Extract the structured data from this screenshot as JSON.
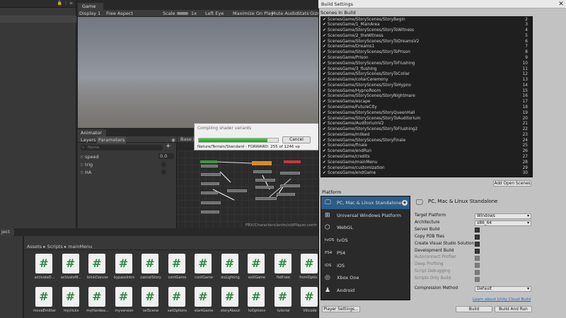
{
  "hierarchy": {
    "icons": "🔒 ⋮ ≡"
  },
  "game": {
    "tab_label": "Game",
    "display": "Display 1",
    "aspect": "Free Aspect",
    "scale_label": "Scale",
    "scale_value": "1x",
    "eye": "Left Eye",
    "maximize": "Maximize On Play",
    "mute": "Mute Audio",
    "stats": "Stats",
    "gizmos": "Gizmos"
  },
  "animator": {
    "tab_label": "Animator",
    "layers_tab": "Layers",
    "parameters_tab": "Parameters",
    "base_layer": "Base Layer",
    "search_placeholder": "Name",
    "add_label": "+",
    "params": [
      {
        "name": "speed",
        "value": "0.0"
      },
      {
        "name": "trig",
        "value": ""
      },
      {
        "name": "HA",
        "value": ""
      }
    ],
    "status_path": "FBX/Characters/anim/oldPlayer.contr"
  },
  "compile_dialog": {
    "title": "Compiling shader variants",
    "progress": 0.87,
    "cancel_label": "Cancel",
    "status": "Nature/Terrain/Standard - FORWARD: 255 of 1246 vp"
  },
  "project": {
    "tab_label": "ject",
    "breadcrumb": [
      "Assets",
      "Scripts",
      "mainMenu"
    ],
    "row1": [
      "activateD...",
      "activateM...",
      "blinkDancer",
      "bypassIntro",
      "cancelStory",
      "contGame",
      "contGame",
      "doLighting",
      "exitGame",
      "fieKnee",
      "fromOptio..."
    ],
    "row2": [
      "moveEmitter",
      "myclicks",
      "myHardwa...",
      "myversion",
      "selScene",
      "setOptions",
      "startGame",
      "storyAbout",
      "toOptions",
      "tutorial",
      "Viiicode"
    ]
  },
  "build_settings": {
    "window_title": "Build Settings",
    "close_icon": "✕",
    "scenes_header": "Scenes In Build",
    "scenes": [
      {
        "name": "ScenesGame/StoryScenes/StoryBegin",
        "index": "2"
      },
      {
        "name": "ScenesGame/1_MainArea",
        "index": "3"
      },
      {
        "name": "ScenesGame/StoryScenes/StoryToWitness",
        "index": "4"
      },
      {
        "name": "ScenesGame/2_theWitness",
        "index": "5"
      },
      {
        "name": "ScenesGame/StoryScenes/StoryToDreamsV2",
        "index": "6"
      },
      {
        "name": "ScenesGame/Dreams1",
        "index": "7"
      },
      {
        "name": "ScenesGame/StoryScenes/StoryToPrison",
        "index": "8"
      },
      {
        "name": "ScenesGame/Prison",
        "index": "9"
      },
      {
        "name": "ScenesGame/StoryScenes/StoryToFlushing",
        "index": "10"
      },
      {
        "name": "ScenesGame/3_flushing",
        "index": "11"
      },
      {
        "name": "ScenesGame/StoryScenes/StoryToCollar",
        "index": "12"
      },
      {
        "name": "ScenesGame/collarCeremony",
        "index": "13"
      },
      {
        "name": "ScenesGame/StoryScenes/StoryToHypno",
        "index": "14"
      },
      {
        "name": "ScenesGame/HypnoRoom",
        "index": "15"
      },
      {
        "name": "ScenesGame/StoryScenes/StoryNightmare",
        "index": "16"
      },
      {
        "name": "ScenesGame/escape",
        "index": "17"
      },
      {
        "name": "ScenesGame/FutureCity",
        "index": "18"
      },
      {
        "name": "ScenesGame/StoryScenes/StoryQueenHall",
        "index": "19"
      },
      {
        "name": "ScenesGame/StoryScenes/StoryToAuditorium",
        "index": "20"
      },
      {
        "name": "ScenesGame/AuditoriumV2",
        "index": "21"
      },
      {
        "name": "ScenesGame/StoryScenes/StoryToFlushing2",
        "index": "22"
      },
      {
        "name": "ScenesGame/milked",
        "index": "23"
      },
      {
        "name": "ScenesGame/StoryScenes/StoryFinale",
        "index": "24"
      },
      {
        "name": "ScenesGame/finale",
        "index": "25"
      },
      {
        "name": "ScenesGame/endRun",
        "index": "26"
      },
      {
        "name": "ScenesGame/credits",
        "index": "27"
      },
      {
        "name": "ScenesGame/mainMenu",
        "index": "28"
      },
      {
        "name": "ScenesGame/customization",
        "index": "29"
      },
      {
        "name": "ScenesGame/endGame",
        "index": "30"
      }
    ],
    "add_open_scenes": "Add Open Scenes",
    "platform_label": "Platform",
    "platforms": [
      {
        "icon": "🖵",
        "label": "PC, Mac & Linux Standalone",
        "selected": true
      },
      {
        "icon": "⊞",
        "label": "Universal Windows Platform",
        "selected": false
      },
      {
        "icon": "⬡",
        "label": "WebGL",
        "selected": false
      },
      {
        "icon": "tvOS",
        "label": "tvOS",
        "selected": false
      },
      {
        "icon": "PS4",
        "label": "PS4",
        "selected": false
      },
      {
        "icon": "iOS",
        "label": "iOS",
        "selected": false
      },
      {
        "icon": "◎",
        "label": "Xbox One",
        "selected": false
      },
      {
        "icon": "♟",
        "label": "Android",
        "selected": false
      }
    ],
    "selected_platform_title": "PC, Mac & Linux Standalone",
    "settings": [
      {
        "label": "Target Platform",
        "type": "select",
        "value": "Windows",
        "dim": false
      },
      {
        "label": "Architecture",
        "type": "select",
        "value": "x86_64",
        "dim": false
      },
      {
        "label": "Server Build",
        "type": "check",
        "dim": false
      },
      {
        "label": "Copy PDB files",
        "type": "check",
        "dim": false
      },
      {
        "label": "Create Visual Studio Solution",
        "type": "check",
        "dim": false
      },
      {
        "label": "Development Build",
        "type": "check",
        "dim": false
      },
      {
        "label": "Autoconnect Profiler",
        "type": "check",
        "dim": true
      },
      {
        "label": "Deep Profiling",
        "type": "check",
        "dim": true
      },
      {
        "label": "Script Debugging",
        "type": "check",
        "dim": true
      },
      {
        "label": "Scripts Only Build",
        "type": "check",
        "dim": true
      }
    ],
    "compression_label": "Compression Method",
    "compression_value": "Default",
    "learn_link": "Learn about Unity Cloud Build",
    "player_settings": "Player Settings...",
    "build": "Build",
    "build_and_run": "Build And Run"
  }
}
